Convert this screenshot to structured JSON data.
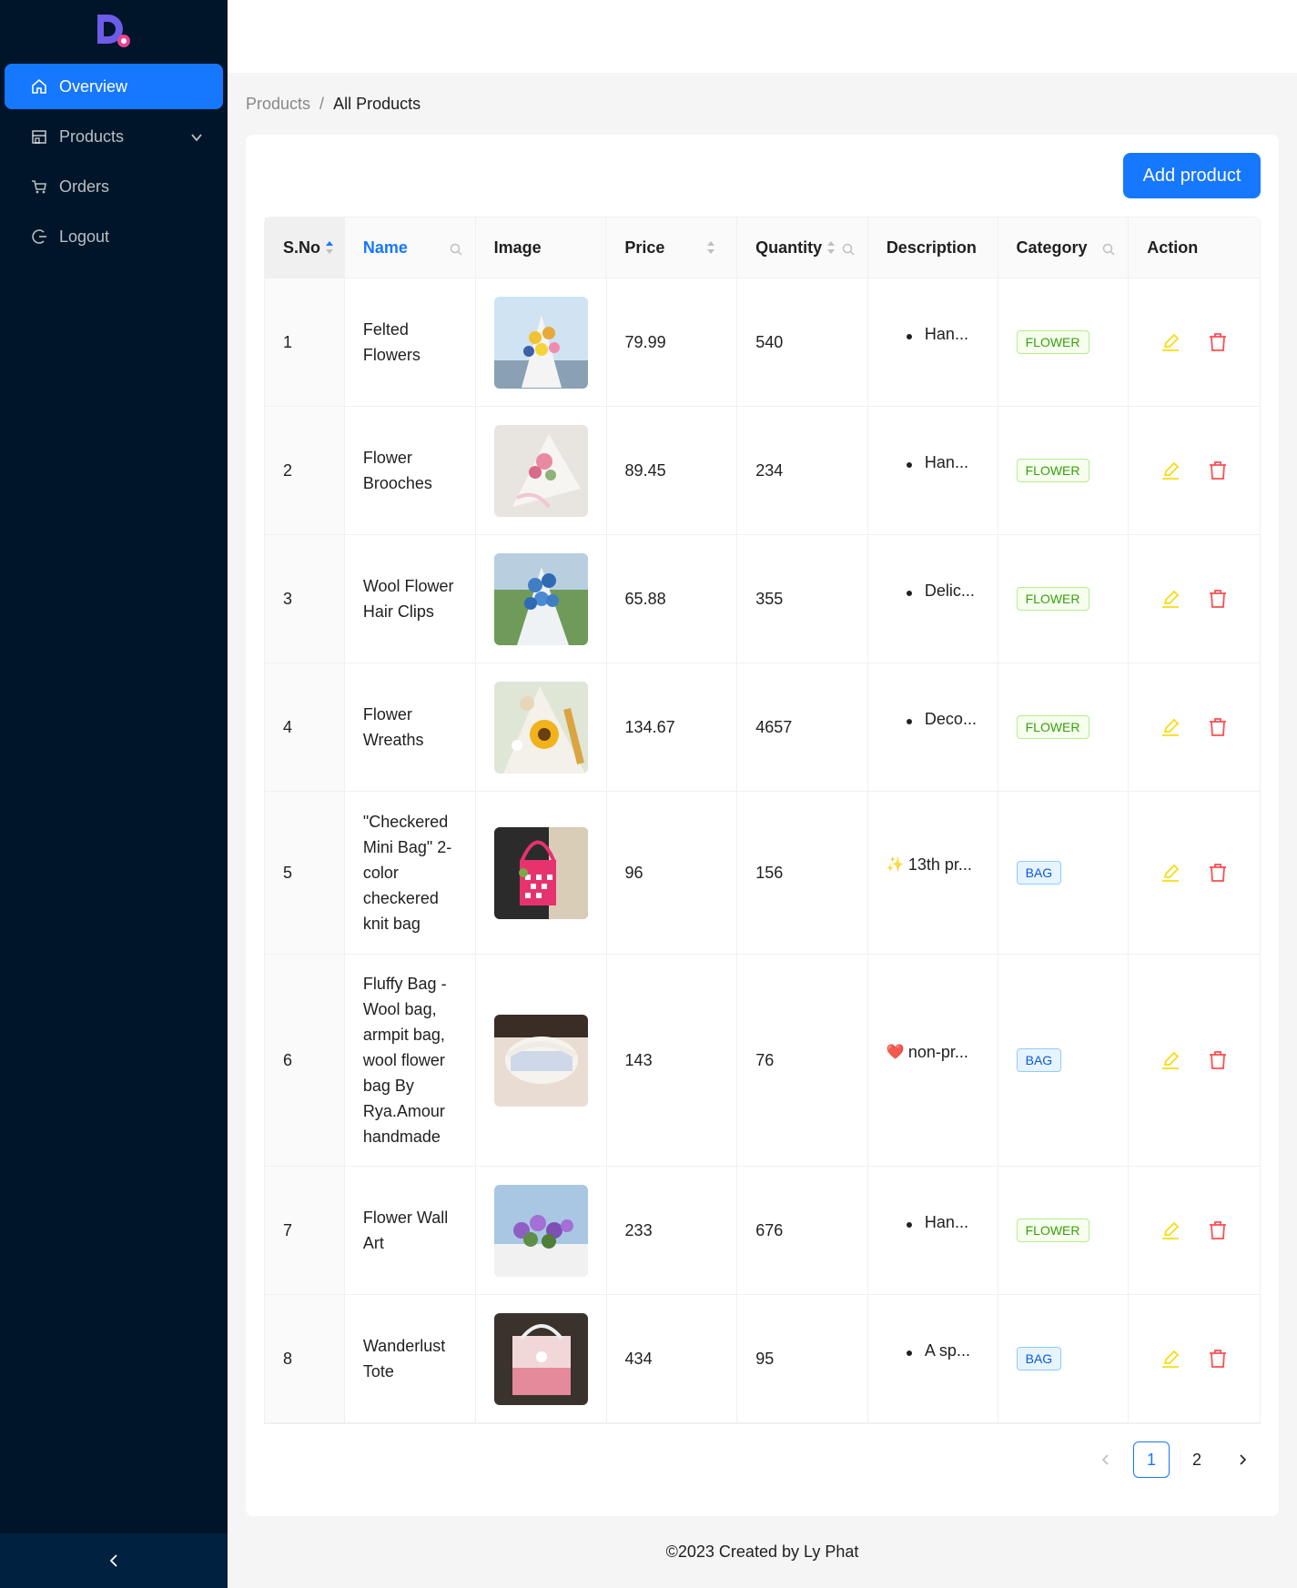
{
  "sidebar": {
    "items": [
      {
        "label": "Overview",
        "icon": "home-icon"
      },
      {
        "label": "Products",
        "icon": "shop-icon"
      },
      {
        "label": "Orders",
        "icon": "cart-icon"
      },
      {
        "label": "Logout",
        "icon": "logout-icon"
      }
    ]
  },
  "breadcrumb": {
    "parent": "Products",
    "separator": "/",
    "current": "All Products"
  },
  "toolbar": {
    "add_label": "Add product"
  },
  "table": {
    "columns": [
      "S.No",
      "Name",
      "Image",
      "Price",
      "Quantity",
      "Description",
      "Category",
      "Action"
    ],
    "rows": [
      {
        "sno": "1",
        "name": "Felted Flowers",
        "price": "79.99",
        "quantity": "540",
        "description": "Han...",
        "desc_prefix": "bullet",
        "category": "FLOWER"
      },
      {
        "sno": "2",
        "name": "Flower Brooches",
        "price": "89.45",
        "quantity": "234",
        "description": "Han...",
        "desc_prefix": "bullet",
        "category": "FLOWER"
      },
      {
        "sno": "3",
        "name": "Wool Flower Hair Clips",
        "price": "65.88",
        "quantity": "355",
        "description": "Delic...",
        "desc_prefix": "bullet",
        "category": "FLOWER"
      },
      {
        "sno": "4",
        "name": "Flower Wreaths",
        "price": "134.67",
        "quantity": "4657",
        "description": "Deco...",
        "desc_prefix": "bullet",
        "category": "FLOWER"
      },
      {
        "sno": "5",
        "name": "\"Checkered Mini Bag\" 2-color checkered knit bag",
        "price": "96",
        "quantity": "156",
        "description": "13th pr...",
        "desc_prefix": "✨",
        "category": "BAG"
      },
      {
        "sno": "6",
        "name": "Fluffy Bag - Wool bag, armpit bag, wool flower bag By Rya.Amour handmade",
        "price": "143",
        "quantity": "76",
        "description": "non-pr...",
        "desc_prefix": "❤️",
        "category": "BAG"
      },
      {
        "sno": "7",
        "name": "Flower Wall Art",
        "price": "233",
        "quantity": "676",
        "description": "Han...",
        "desc_prefix": "bullet",
        "category": "FLOWER"
      },
      {
        "sno": "8",
        "name": "Wanderlust Tote",
        "price": "434",
        "quantity": "95",
        "description": "A sp...",
        "desc_prefix": "bullet",
        "category": "BAG"
      }
    ]
  },
  "pagination": {
    "pages": [
      "1",
      "2"
    ],
    "current": "1"
  },
  "footer": {
    "text": "©2023 Created by Ly Phat"
  },
  "colors": {
    "primary": "#1677ff",
    "sidebar": "#001529",
    "edit": "#fadb14",
    "delete": "#ff4d4f"
  }
}
